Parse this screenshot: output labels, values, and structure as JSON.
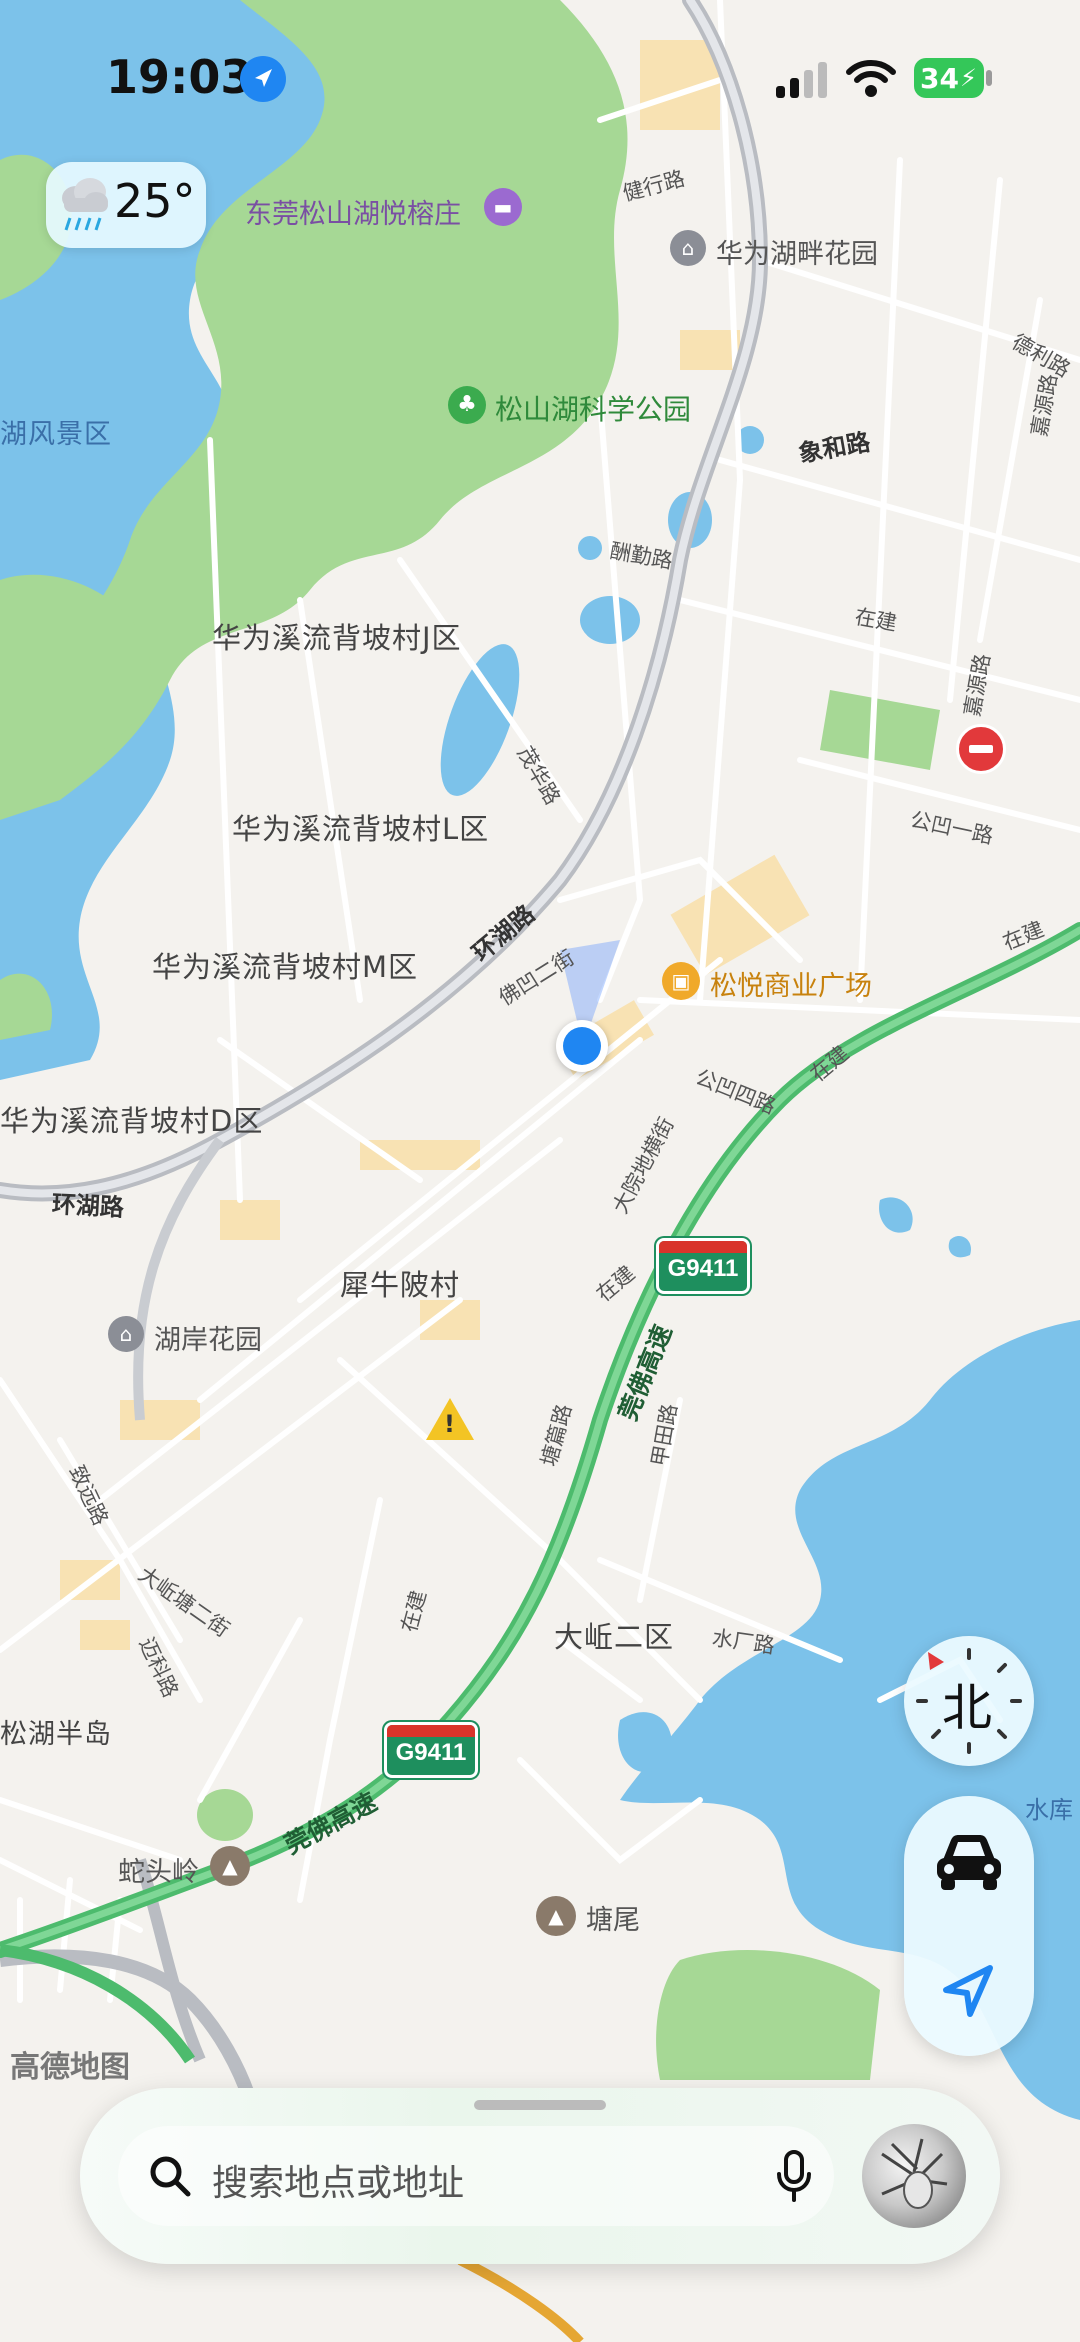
{
  "status_bar": {
    "time": "19:03",
    "battery": "34"
  },
  "weather": {
    "temperature": "25°"
  },
  "map": {
    "districts": [
      "华为溪流背坡村J区",
      "华为溪流背坡村L区",
      "华为溪流背坡村M区",
      "华为溪流背坡村D区",
      "犀牛陂村",
      "大岴二区",
      "松湖半岛",
      "湖风景区"
    ],
    "pois": {
      "hotel": "东莞松山湖悦榕庄",
      "park": "松山湖科学公园",
      "residence_1": "华为湖畔花园",
      "residence_2": "湖岸花园",
      "mall": "松悦商业广场",
      "mountain_1": "蛇头岭",
      "mountain_2": "塘尾",
      "reservoir": "水库"
    },
    "roads": [
      "健行路",
      "象和路",
      "德利路",
      "嘉源路",
      "酬勤路",
      "在建",
      "嘉源路",
      "公凹一路",
      "茂华路",
      "环湖路",
      "佛凹二街",
      "公凹四路",
      "在建",
      "大院地横街",
      "环湖路",
      "在建",
      "莞佛高速",
      "塘篇路",
      "甲田路",
      "致远路",
      "大岴塘二街",
      "迈科路",
      "水厂路",
      "在建",
      "莞佛高速",
      "在建"
    ],
    "highway_shields": [
      "G9411",
      "G9411"
    ],
    "watermark": "高德地图"
  },
  "compass": {
    "label": "北"
  },
  "search": {
    "placeholder": "搜索地点或地址"
  }
}
